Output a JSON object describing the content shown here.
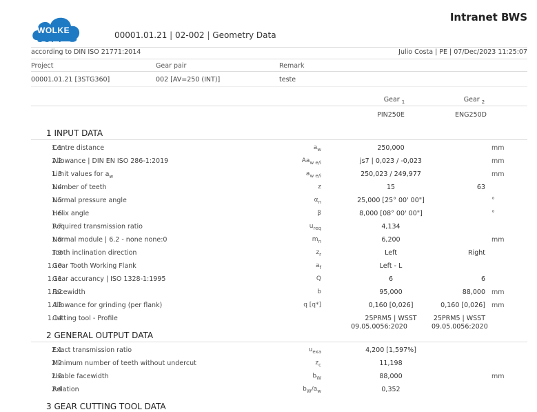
{
  "header": {
    "logo_text_top": "WOLKE",
    "logo_text_bottom": "SOFT",
    "doc_number": "00001.01.21",
    "doc_module": "02-002",
    "doc_title": "Geometry Data",
    "app_title": "Intranet BWS",
    "standard": "according to DIN ISO 21771:2014",
    "user_info": "Julio Costa | PE | 07/Dec/2023 11:25:07"
  },
  "project": {
    "project_label": "Project",
    "gearpair_label": "Gear pair",
    "remark_label": "Remark",
    "project_value": "00001.01.21 [3STG360]",
    "gearpair_value": "002 [AV=250 (INT)]",
    "remark_value": "teste"
  },
  "gears": {
    "gear1_label": "Gear",
    "gear1_index": "1",
    "gear2_label": "Gear",
    "gear2_index": "2",
    "gear1_name": "PIN250E",
    "gear2_name": "ENG250D"
  },
  "sections": {
    "input_title": "1 INPUT DATA",
    "output_title": "2 GENERAL OUTPUT DATA",
    "tool_title": "3 GEAR CUTTING TOOL DATA"
  },
  "input_rows": [
    {
      "num": "1.1",
      "label": "Centre distance",
      "sym": "a",
      "sub": "w",
      "v1": "250,000",
      "v2": "",
      "unit": "mm"
    },
    {
      "num": "1.2",
      "label": "Allowance | DIN EN ISO 286-1:2019",
      "sym": "Aa",
      "sub": "w e/i",
      "v1": "js7 | 0,023 / -0,023",
      "v2": "",
      "unit": "mm"
    },
    {
      "num": "1.3",
      "label": "Limit values for a",
      "label_sub": "w",
      "sym": "a",
      "sub": "w e/i",
      "v1": "250,023 / 249,977",
      "v2": "",
      "unit": "mm"
    },
    {
      "num": "1.4",
      "label": "Number of teeth",
      "sym": "z",
      "sub": "",
      "v1": "15",
      "v2": "63",
      "unit": ""
    },
    {
      "num": "1.5",
      "label": "Normal pressure angle",
      "sym": "α",
      "sub": "n",
      "v1": "25,000 [25° 00' 00\"]",
      "v2": "",
      "unit": "°"
    },
    {
      "num": "1.6",
      "label": "Helix angle",
      "sym": "β",
      "sub": "",
      "v1": "8,000 [08° 00' 00\"]",
      "v2": "",
      "unit": "°"
    },
    {
      "num": "1.7",
      "label": "Required transmission ratio",
      "sym": "u",
      "sub": "req",
      "v1": "4,134",
      "v2": "",
      "unit": ""
    },
    {
      "num": "1.8",
      "label": "Normal module | 6.2 - none none:0",
      "sym": "m",
      "sub": "n",
      "v1": "6,200",
      "v2": "",
      "unit": "mm"
    },
    {
      "num": "1.9",
      "label": "Tooth inclination direction",
      "sym": "z",
      "sub": "r",
      "v1": "Left",
      "v2": "Right",
      "unit": ""
    },
    {
      "num": "1.10",
      "label": "Gear Tooth Working Flank",
      "sym": "a",
      "sub": "f",
      "v1": "Left - L",
      "v2": "",
      "unit": ""
    },
    {
      "num": "1.11",
      "label": "Gear accurancy | ISO 1328-1:1995",
      "sym": "Q",
      "sub": "",
      "v1": "6",
      "v2": "6",
      "unit": ""
    },
    {
      "num": "1.12",
      "label": "Facewidth",
      "sym": "b",
      "sub": "",
      "v1": "95,000",
      "v2": "88,000",
      "unit": "mm"
    },
    {
      "num": "1.13",
      "label": "Allowance for grinding (per flank)",
      "sym": "q [q*]",
      "sub": "",
      "v1": "0,160 [0,026]",
      "v2": "0,160 [0,026]",
      "unit": "mm"
    },
    {
      "num": "1.14",
      "label": "Cutting tool - Profile",
      "sym": "",
      "sub": "",
      "v1": "25PRM5 | WSST",
      "v1b": "09.05.0056:2020",
      "v2": "25PRM5 | WSST",
      "v2b": "09.05.0056:2020",
      "unit": ""
    }
  ],
  "output_rows": [
    {
      "num": "2.1",
      "label": "Exact transmission ratio",
      "sym": "u",
      "sub": "exa",
      "v1": "4,200 [1,597%]",
      "v2": "",
      "unit": ""
    },
    {
      "num": "2.2",
      "label": "Minimum number of teeth without undercut",
      "sym": "z",
      "sub": "c",
      "v1": "11,198",
      "v2": "",
      "unit": ""
    },
    {
      "num": "2.3",
      "label": "Usable facewidth",
      "sym": "b",
      "sub": "W",
      "v1": "88,000",
      "v2": "",
      "unit": "mm"
    },
    {
      "num": "2.4",
      "label": "Relation",
      "sym": "b",
      "sub": "W",
      "sym2": "/a",
      "sub2": "w",
      "v1": "0,352",
      "v2": "",
      "unit": ""
    }
  ]
}
